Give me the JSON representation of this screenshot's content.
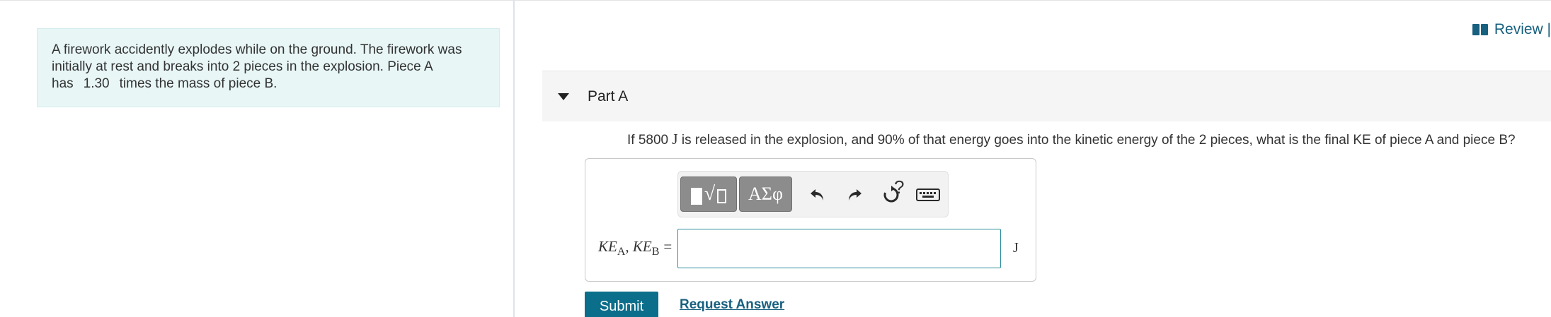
{
  "intro": {
    "line1": "A firework accidently explodes while on the ground. The firework was",
    "line2": "initially at rest and breaks into 2 pieces in the explosion. Piece A",
    "line3_pre": "has",
    "line3_value": "1.30",
    "line3_post": "times the mass of piece B."
  },
  "review": {
    "label": "Review |"
  },
  "part": {
    "title": "Part A"
  },
  "question": {
    "pre": "If 5800 ",
    "unit": "J",
    "post": " is released in the explosion, and 90% of that energy goes into the kinetic energy of the 2 pieces, what is the final KE of piece A and piece B?"
  },
  "toolbar": {
    "symbols_label": "ΑΣφ",
    "help_label": "?"
  },
  "answer": {
    "var_ke1": "KE",
    "sub1": "A",
    "comma": ", ",
    "var_ke2": "KE",
    "sub2": "B",
    "equals": "=",
    "value": "",
    "unit": "J"
  },
  "actions": {
    "submit_label": "Submit",
    "request_label": "Request Answer"
  },
  "colors": {
    "accent": "#0b6e8a",
    "link": "#18607f",
    "intro_bg": "#e8f6f6"
  }
}
